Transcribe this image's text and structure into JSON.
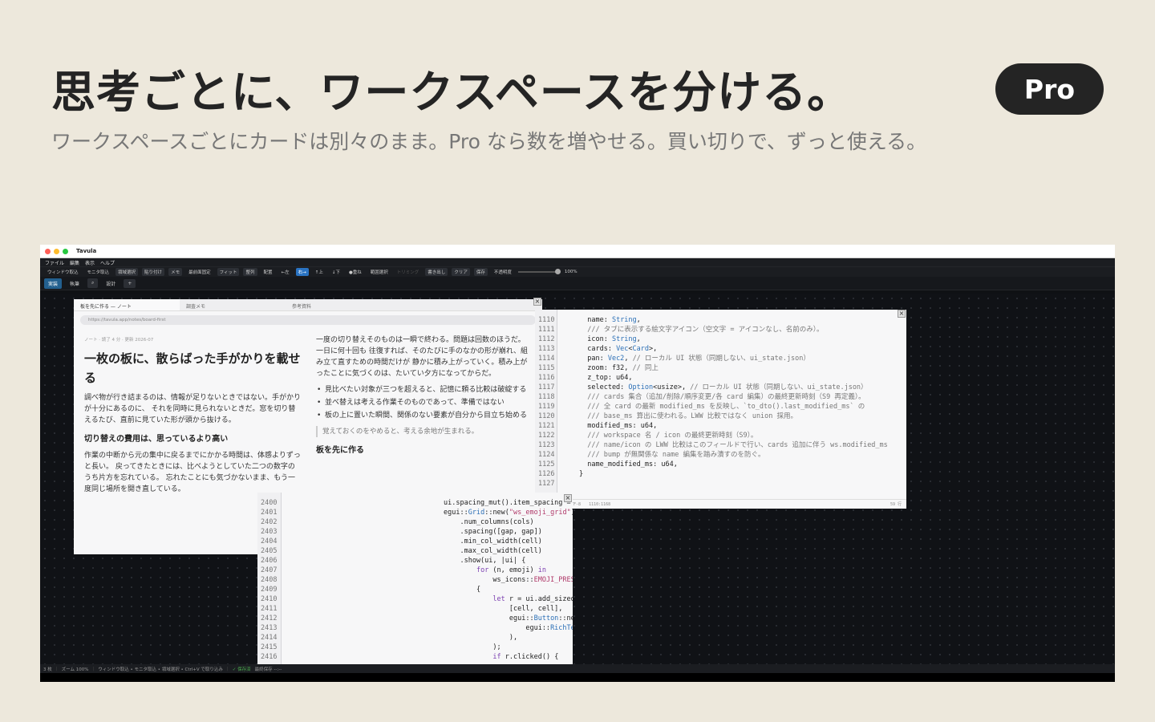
{
  "hero": {
    "title": "思考ごとに、ワークスペースを分ける。",
    "subtitle": "ワークスペースごとにカードは別々のまま。Pro なら数を増やせる。買い切りで、ずっと使える。",
    "badge": "Pro"
  },
  "app": {
    "window_title": "Tavula",
    "menu": [
      "ファイル",
      "編集",
      "表示",
      "ヘルプ"
    ],
    "toolbar": {
      "capture_window": "ウィンドウ取込",
      "capture_monitor": "モニタ取込",
      "region_select": "領域選択",
      "paste": "貼り付け",
      "memo": "メモ",
      "pin_front": "最前面固定",
      "fit": "フィット",
      "arrange": "整列",
      "layout_label": "配置",
      "left": "←左",
      "right": "右→",
      "up": "↑上",
      "down": "↓下",
      "stack": "●重ね",
      "range_select": "範囲選択",
      "trim": "トリミング",
      "export": "書き出し",
      "clear": "クリア",
      "save": "保存",
      "opacity_label": "不透明度",
      "opacity_value": "100%",
      "opacity_level": 1.0
    },
    "workspaces": [
      "実装",
      "執筆",
      "設計"
    ],
    "workspace_search": "⌕",
    "add_workspace": "+",
    "note_card": {
      "tabs": [
        "板を先に作る — ノート",
        "調査メモ",
        "参考資料"
      ],
      "url": "https://tavula.app/notes/board-first",
      "meta": "ノート · 読了 4 分 · 更新 2026-07",
      "title": "一枚の板に、散らばった手がかりを載せる",
      "para1": "調べ物が行き詰まるのは、情報が足りないときではない。手がかりが十分にあるのに、 それを同時に見られないときだ。窓を切り替えるたび、直前に見ていた形が頭から抜ける。",
      "heading2": "切り替えの費用は、思っているより高い",
      "para2": "作業の中断から元の集中に戻るまでにかかる時間は、体感よりずっと長い。 戻ってきたときには、比べようとしていた二つの数字のうち片方を忘れている。 忘れたことにも気づかないまま、もう一度同じ場所を開き直している。",
      "right_para": "一度の切り替えそのものは一瞬で終わる。問題は回数のほうだ。一日に何十回も 往復すれば、そのたびに手のなかの形が崩れ、組み立て直すための時間だけが 静かに積み上がっていく。積み上がったことに気づくのは、たいてい夕方になってからだ。",
      "bullets": [
        "見比べたい対象が三つを超えると、記憶に頼る比較は破綻する",
        "並べ替えは考える作業そのものであって、準備ではない",
        "板の上に置いた瞬間、関係のない要素が自分から目立ち始める"
      ],
      "quote": "覚えておくのをやめると、考える余地が生まれる。",
      "heading3": "板を先に作る"
    },
    "code_card_1": {
      "line_numbers": [
        "1110",
        "1111",
        "1112",
        "1113",
        "1114",
        "1115",
        "1116",
        "1117",
        "1118",
        "1119",
        "1120",
        "1121",
        "1122",
        "1123",
        "1124",
        "1125",
        "1126",
        "1127"
      ],
      "status_encoding": "UTF-8",
      "status_position": "1110:1168",
      "status_lines": "59 行"
    },
    "code_card_2": {
      "line_numbers": [
        "2400",
        "2401",
        "2402",
        "2403",
        "2404",
        "2405",
        "2406",
        "2407",
        "2408",
        "2409",
        "2410",
        "2411",
        "2412",
        "2413",
        "2414",
        "2415",
        "2416"
      ]
    },
    "status": {
      "count": "3 枚",
      "zoom": "ズーム 100%",
      "hint": "ウィンドウ取込 • モニタ取込 • 領域選択 • Ctrl+V で取り込み",
      "saved": "✓ 保存済",
      "last_saved": "最終保存 --:--"
    }
  }
}
